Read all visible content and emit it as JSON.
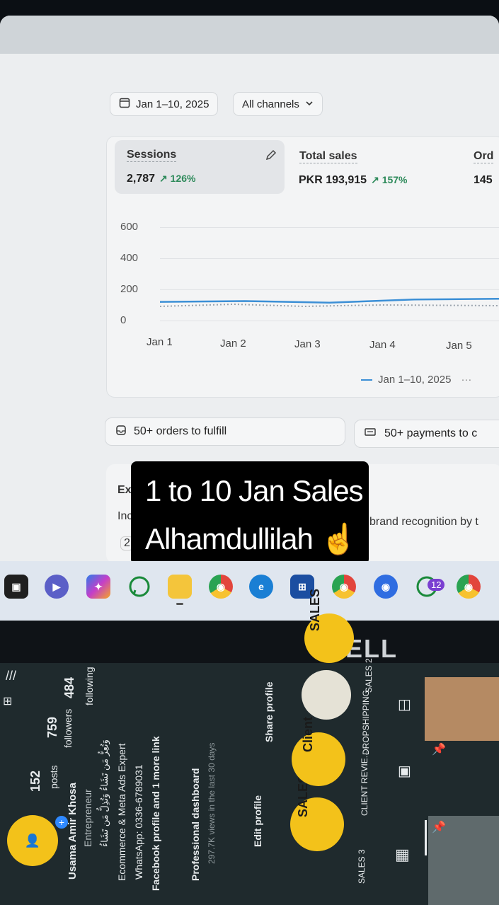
{
  "dashboard": {
    "date_range": "Jan 1–10, 2025",
    "channel_filter": "All channels",
    "metrics": [
      {
        "label": "Sessions",
        "value": "2,787",
        "change": "126%"
      },
      {
        "label": "Total sales",
        "value": "PKR 193,915",
        "change": "157%"
      },
      {
        "label": "Ord",
        "value": "145",
        "change": ""
      }
    ],
    "y_ticks": [
      "600",
      "400",
      "200",
      "0"
    ],
    "x_ticks": [
      "Jan 1",
      "Jan 2",
      "Jan 3",
      "Jan 4",
      "Jan 5"
    ],
    "legend_label": "Jan 1–10, 2025",
    "legend_more": "···",
    "orders_to_fulfill": "50+ orders to fulfill",
    "payments_to_capture": "50+ payments to c",
    "panel_heading_partial": "Ex",
    "panel_text_left": "Inc",
    "panel_text_right": "brand recognition by t",
    "panel_chip": "2"
  },
  "chart_data": {
    "type": "line",
    "x": [
      "Jan 1",
      "Jan 2",
      "Jan 3",
      "Jan 4",
      "Jan 5"
    ],
    "series": [
      {
        "name": "Jan 1–10, 2025",
        "values": [
          120,
          125,
          115,
          135,
          140
        ]
      }
    ],
    "ylim": [
      0,
      600
    ]
  },
  "overlay": {
    "line1": "1 to 10 Jan Sales",
    "line2": "Alhamdullilah ☝️"
  },
  "taskbar": {
    "whatsapp_badge": "12"
  },
  "laptop_brand": "DELL",
  "phone": {
    "profile_name": "Usama Amir Khosa",
    "role": "Entrepreneur",
    "arabic_line": "وَتُعِزُّ مَن تَشَاءُ وَتُذِلُّ مَن تَشَاءُ",
    "bio_line1": "Ecommerce & Meta Ads Expert",
    "whatsapp_line": "WhatsApp: 0336-6789031",
    "facebook_link": "Facebook profile and 1 more link",
    "posts_count": "152",
    "posts_label": "posts",
    "followers_count": "759",
    "followers_label": "followers",
    "following_count": "484",
    "following_label": "following",
    "professional_dashboard": "Professional dashboard",
    "views_note": "297.7K views in the last 30 days",
    "edit_profile": "Edit profile",
    "share_profile": "Share profile",
    "highlights": [
      "SALES 3",
      "CLIENT REVIE...",
      "DROPSHIPPING",
      "SALES 2"
    ],
    "highlight_badges": [
      "SALES",
      "Client",
      "SALES"
    ]
  }
}
